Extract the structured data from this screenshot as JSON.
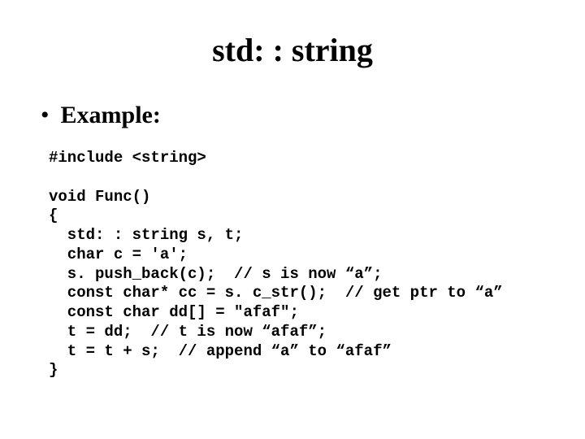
{
  "title": "std: : string",
  "bullet": "Example:",
  "code": "#include <string>\n\nvoid Func()\n{\n  std: : string s, t;\n  char c = 'a';\n  s. push_back(c);  // s is now “a”;\n  const char* cc = s. c_str();  // get ptr to “a”\n  const char dd[] = \"afaf\";\n  t = dd;  // t is now “afaf”;\n  t = t + s;  // append “a” to “afaf”\n}"
}
